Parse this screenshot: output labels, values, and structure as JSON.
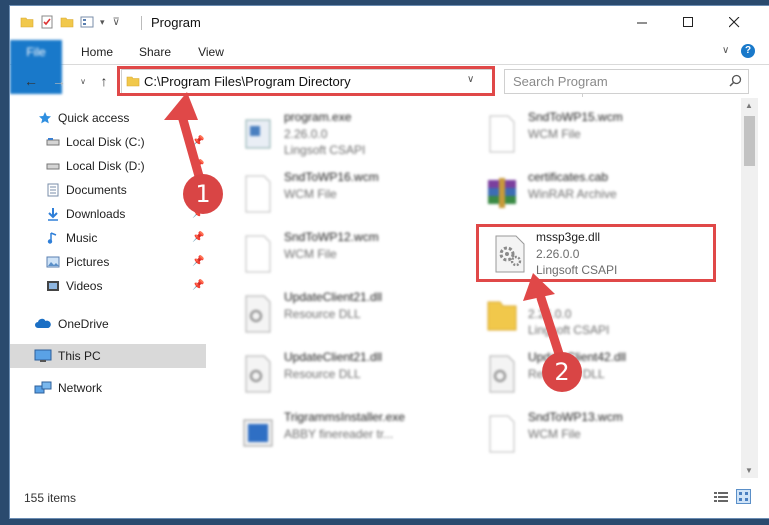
{
  "window": {
    "title": "Program",
    "ribbon_tabs": [
      "File",
      "Home",
      "Share",
      "View"
    ],
    "help_char": "?"
  },
  "address": {
    "path": "C:\\Program Files\\Program Directory"
  },
  "search": {
    "placeholder": "Search Program"
  },
  "nav": {
    "items": [
      {
        "label": "Quick access",
        "icon": "star-icon",
        "pinned": false
      },
      {
        "label": "Local Disk (C:)",
        "icon": "drive-icon",
        "pinned": true
      },
      {
        "label": "Local Disk (D:)",
        "icon": "drive-icon",
        "pinned": true
      },
      {
        "label": "Documents",
        "icon": "documents-icon",
        "pinned": true
      },
      {
        "label": "Downloads",
        "icon": "download-icon",
        "pinned": true
      },
      {
        "label": "Music",
        "icon": "music-icon",
        "pinned": true
      },
      {
        "label": "Pictures",
        "icon": "pictures-icon",
        "pinned": true
      },
      {
        "label": "Videos",
        "icon": "videos-icon",
        "pinned": true
      },
      {
        "label": "OneDrive",
        "icon": "cloud-icon",
        "pinned": false
      },
      {
        "label": "This PC",
        "icon": "pc-icon",
        "pinned": false
      },
      {
        "label": "Network",
        "icon": "network-icon",
        "pinned": false
      }
    ]
  },
  "files": [
    {
      "name": "program.exe",
      "l2": "2.26.0.0",
      "l3": "Lingsoft CSAPI",
      "icon": "exe-icon"
    },
    {
      "name": "SndToWP15.wcm",
      "l2": "WCM File",
      "l3": "",
      "icon": "file-icon"
    },
    {
      "name": "SndToWP16.wcm",
      "l2": "WCM File",
      "l3": "",
      "icon": "file-icon"
    },
    {
      "name": "certificates.cab",
      "l2": "WinRAR Archive",
      "l3": "",
      "icon": "archive-icon"
    },
    {
      "name": "SndToWP12.wcm",
      "l2": "WCM File",
      "l3": "",
      "icon": "file-icon"
    },
    {
      "name": "mssp3ge.dll",
      "l2": "2.26.0.0",
      "l3": "Lingsoft CSAPI",
      "icon": "dll-icon"
    },
    {
      "name": "UpdateClient21.dll",
      "l2": "Resource DLL",
      "l3": "",
      "icon": "dll-icon"
    },
    {
      "name": "",
      "l2": "2.26.0.0",
      "l3": "Lingsoft CSAPI",
      "icon": "folder-icon"
    },
    {
      "name": "UpdateClient21.dll",
      "l2": "Resource DLL",
      "l3": "",
      "icon": "dll-icon"
    },
    {
      "name": "UpdateClient42.dll",
      "l2": "Resource DLL",
      "l3": "",
      "icon": "dll-icon"
    },
    {
      "name": "TrigrammsInstaller.exe",
      "l2": "ABBY finereader tr...",
      "l3": "",
      "icon": "installer-icon"
    },
    {
      "name": "SndToWP13.wcm",
      "l2": "WCM File",
      "l3": "",
      "icon": "file-icon"
    }
  ],
  "status": {
    "items_count": "155 items"
  },
  "annotations": [
    {
      "number": "1",
      "color": "#d94545"
    },
    {
      "number": "2",
      "color": "#d94545"
    }
  ]
}
